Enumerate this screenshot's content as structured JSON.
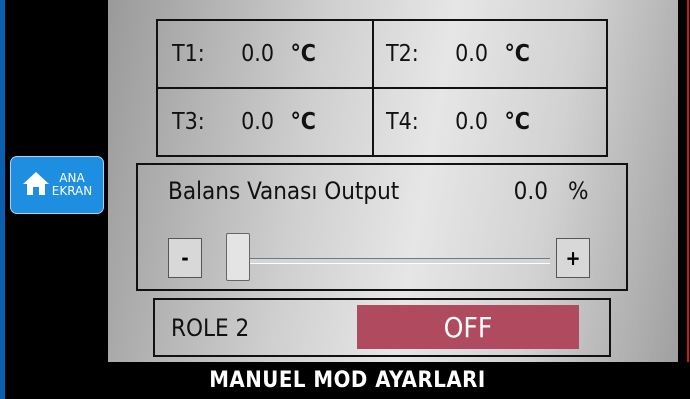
{
  "nav": {
    "home_line1": "ANA",
    "home_line2": "EKRAN"
  },
  "temperatures": [
    {
      "label": "T1:",
      "value": "0.0",
      "unit": "°C"
    },
    {
      "label": "T2:",
      "value": "0.0",
      "unit": "°C"
    },
    {
      "label": "T3:",
      "value": "0.0",
      "unit": "°C"
    },
    {
      "label": "T4:",
      "value": "0.0",
      "unit": "°C"
    }
  ],
  "balance": {
    "title": "Balans Vanası Output",
    "value": "0.0",
    "unit": "%",
    "minus_label": "-",
    "plus_label": "+",
    "slider_level": 0
  },
  "relay": {
    "label": "ROLE 2",
    "state": "OFF",
    "state_color": "#b04a5e"
  },
  "footer": {
    "title": "MANUEL MOD AYARLARI"
  },
  "colors": {
    "home_button": "#1e8fe0",
    "frame": "#0a5fb0"
  },
  "icons": {
    "home": "home-icon"
  }
}
